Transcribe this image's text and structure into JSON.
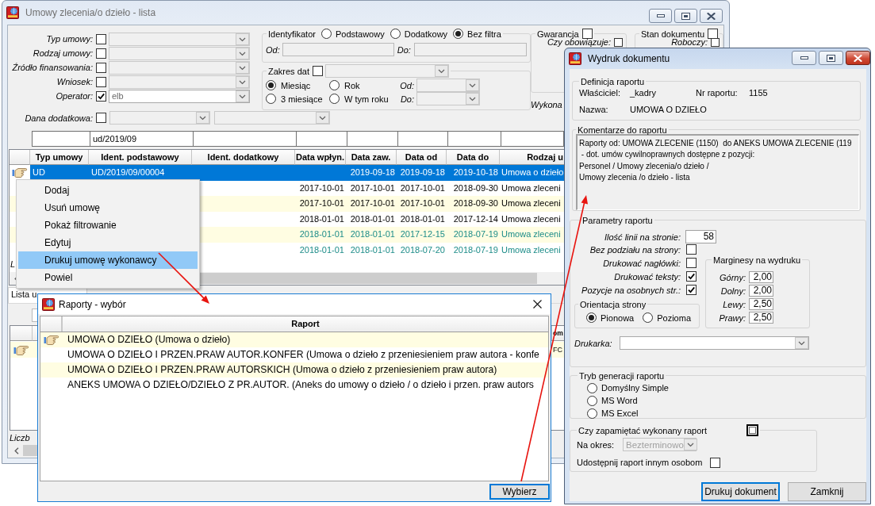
{
  "main_window": {
    "title": "Umowy zlecenia/o dzieło - lista",
    "active": false,
    "filters": [
      {
        "label": "Typ umowy:",
        "checked": false
      },
      {
        "label": "Rodzaj umowy:",
        "checked": false
      },
      {
        "label": "Źródło finansowania:",
        "checked": false
      },
      {
        "label": "Wniosek:",
        "checked": false
      },
      {
        "label": "Operator:",
        "checked": true,
        "value": "elb"
      }
    ],
    "identifier": {
      "title": "Identyfikator",
      "options": [
        {
          "label": "Podstawowy",
          "selected": false
        },
        {
          "label": "Dodatkowy",
          "selected": false
        },
        {
          "label": "Bez filtra",
          "selected": true
        }
      ],
      "from_label": "Od:",
      "to_label": "Do:"
    },
    "date_range": {
      "title": "Zakres dat",
      "checked": false,
      "options": [
        {
          "label": "Miesiąc",
          "selected": true
        },
        {
          "label": "Rok",
          "selected": false
        },
        {
          "label": "3 miesiące",
          "selected": false
        },
        {
          "label": "W tym roku",
          "selected": false
        }
      ],
      "from_label": "Od:",
      "to_label": "Do:"
    },
    "guarantee": {
      "title": "Gwarancja",
      "checked": false,
      "sub_label": "Czy obowiązuje:",
      "sub_checked": false
    },
    "document_state": {
      "title": "Stan dokumentu",
      "checked": false,
      "sub_label": "Roboczy:",
      "sub_checked": false
    },
    "performer_label": "Wykona",
    "extra_data": {
      "label": "Dana dodatkowa:",
      "checked": false
    },
    "table": {
      "columns": [
        {
          "label": "Typ umowy"
        },
        {
          "label": "Ident. podstawowy",
          "filter": "ud/2019/09"
        },
        {
          "label": "Ident. dodatkowy"
        },
        {
          "label": "Data wpłyn."
        },
        {
          "label": "Data zaw."
        },
        {
          "label": "Data od"
        },
        {
          "label": "Data do"
        },
        {
          "label": "Rodzaj u"
        }
      ],
      "rows": [
        {
          "selected": true,
          "kind": "regular",
          "contract_type": "UD",
          "primary_id": "UD/2019/09/00004",
          "concluded": "2019-09-18",
          "date_from": "2019-09-18",
          "date_to": "2019-10-18",
          "contract_kind": "Umowa o dzieło"
        },
        {
          "selected": false,
          "kind": "regular",
          "received": "2017-10-01",
          "concluded": "2017-10-01",
          "date_from": "2017-10-01",
          "date_to": "2018-09-30",
          "contract_kind": "Umowa zleceni"
        },
        {
          "selected": false,
          "kind": "regular",
          "received": "2017-10-01",
          "concluded": "2017-10-01",
          "date_from": "2017-10-01",
          "date_to": "2018-09-30",
          "contract_kind": "Umowa zleceni"
        },
        {
          "selected": false,
          "kind": "regular",
          "received": "2018-01-01",
          "concluded": "2018-01-01",
          "date_from": "2018-01-01",
          "date_to": "2017-12-14",
          "contract_kind": "Umowa zleceni"
        },
        {
          "selected": false,
          "kind": "highlighted",
          "received": "2018-01-01",
          "concluded": "2018-01-01",
          "date_from": "2017-12-15",
          "date_to": "2018-07-19",
          "contract_kind": "Umowa zleceni"
        },
        {
          "selected": false,
          "kind": "highlighted",
          "received": "2018-01-01",
          "concluded": "2018-01-01",
          "date_from": "2018-07-20",
          "date_to": "2018-07-19",
          "contract_kind": "Umowa zleceni"
        }
      ],
      "count_label": "L"
    },
    "context_menu": [
      {
        "label": "Dodaj",
        "selected": false
      },
      {
        "label": "Usuń umowę",
        "selected": false
      },
      {
        "label": "Pokaż filtrowanie",
        "selected": false
      },
      {
        "label": "Edytuj",
        "selected": false
      },
      {
        "label": "Drukuj umowę wykonawcy",
        "selected": true
      },
      {
        "label": "Powiel",
        "selected": false
      }
    ],
    "tabs": [
      {
        "label": "Lista u",
        "selected": true
      }
    ],
    "detail_table": {
      "column_label": "om",
      "rows": [
        {
          "selected": true,
          "value": "FC"
        }
      ],
      "count_label": "Liczb"
    }
  },
  "report_picker": {
    "title": "Raporty - wybór",
    "column": "Raport",
    "rows": [
      {
        "label": "UMOWA O DZIEŁO (Umowa o dzieło)",
        "selected": true
      },
      {
        "label": "UMOWA O DZIEŁO I PRZEN.PRAW AUTOR.KONFER (Umowa o dzieło z przeniesieniem praw autora - konfe",
        "selected": false
      },
      {
        "label": "UMOWA O DZIEŁO I PRZEN.PRAW AUTORSKICH (Umowa o dzieło z przeniesieniem praw autora)",
        "selected": false
      },
      {
        "label": "ANEKS UMOWA O DZIEŁO/DZIEŁO Z PR.AUTOR. (Aneks do umowy o dzieło / o dzieło i przen. praw autors",
        "selected": false
      }
    ],
    "button": {
      "label": "Wybierz",
      "focused": true
    }
  },
  "print_dialog": {
    "title": "Wydruk dokumentu",
    "active": true,
    "definition": {
      "title": "Definicja raportu",
      "owner_label": "Właściciel:",
      "owner": "_kadry",
      "number_label": "Nr raportu:",
      "number": "1155",
      "name_label": "Nazwa:",
      "name": "UMOWA O DZIEŁO"
    },
    "comments": {
      "title": "Komentarze do raportu",
      "lines": [
        "Raporty od: UMOWA ZLECENIE (1150)  do ANEKS UMOWA ZLECENIE (119",
        " - dot. umów cywilnoprawnych dostępne z pozycji:",
        "Personel / Umowy zlecenia/o dzieło /",
        "Umowy zlecenia /o dzieło - lista"
      ]
    },
    "parameters": {
      "title": "Parametry raportu",
      "lines_label": "Ilość linii na stronie:",
      "lines_value": "58",
      "options": [
        {
          "label": "Bez podziału na strony:",
          "checked": false
        },
        {
          "label": "Drukować nagłówki:",
          "checked": false
        },
        {
          "label": "Drukować teksty:",
          "checked": true
        },
        {
          "label": "Pozycje na osobnych str.:",
          "checked": true
        }
      ],
      "orientation": {
        "title": "Orientacja strony",
        "options": [
          {
            "label": "Pionowa",
            "selected": true
          },
          {
            "label": "Pozioma",
            "selected": false
          }
        ]
      },
      "margins": {
        "title": "Marginesy na wydruku",
        "items": [
          {
            "label": "Górny:",
            "value": "2,00"
          },
          {
            "label": "Dolny:",
            "value": "2,00"
          },
          {
            "label": "Lewy:",
            "value": "2,50"
          },
          {
            "label": "Prawy:",
            "value": "2,50"
          }
        ]
      },
      "printer_label": "Drukarka:"
    },
    "generation_mode": {
      "title": "Tryb generacji raportu",
      "options": [
        {
          "label": "Domyślny Simple",
          "selected": false
        },
        {
          "label": "MS Word",
          "selected": false
        },
        {
          "label": "MS Excel",
          "selected": false
        }
      ]
    },
    "remember": {
      "title": "Czy zapamiętać wykonany raport",
      "checked": false,
      "period_label": "Na okres:",
      "period": "Bezterminowo",
      "period_disabled": true,
      "share_label": "Udostępnij raport innym osobom",
      "share_checked": false
    },
    "buttons": [
      {
        "label": "Drukuj dokument",
        "focused": true
      },
      {
        "label": "Zamknij",
        "focused": false
      }
    ]
  }
}
